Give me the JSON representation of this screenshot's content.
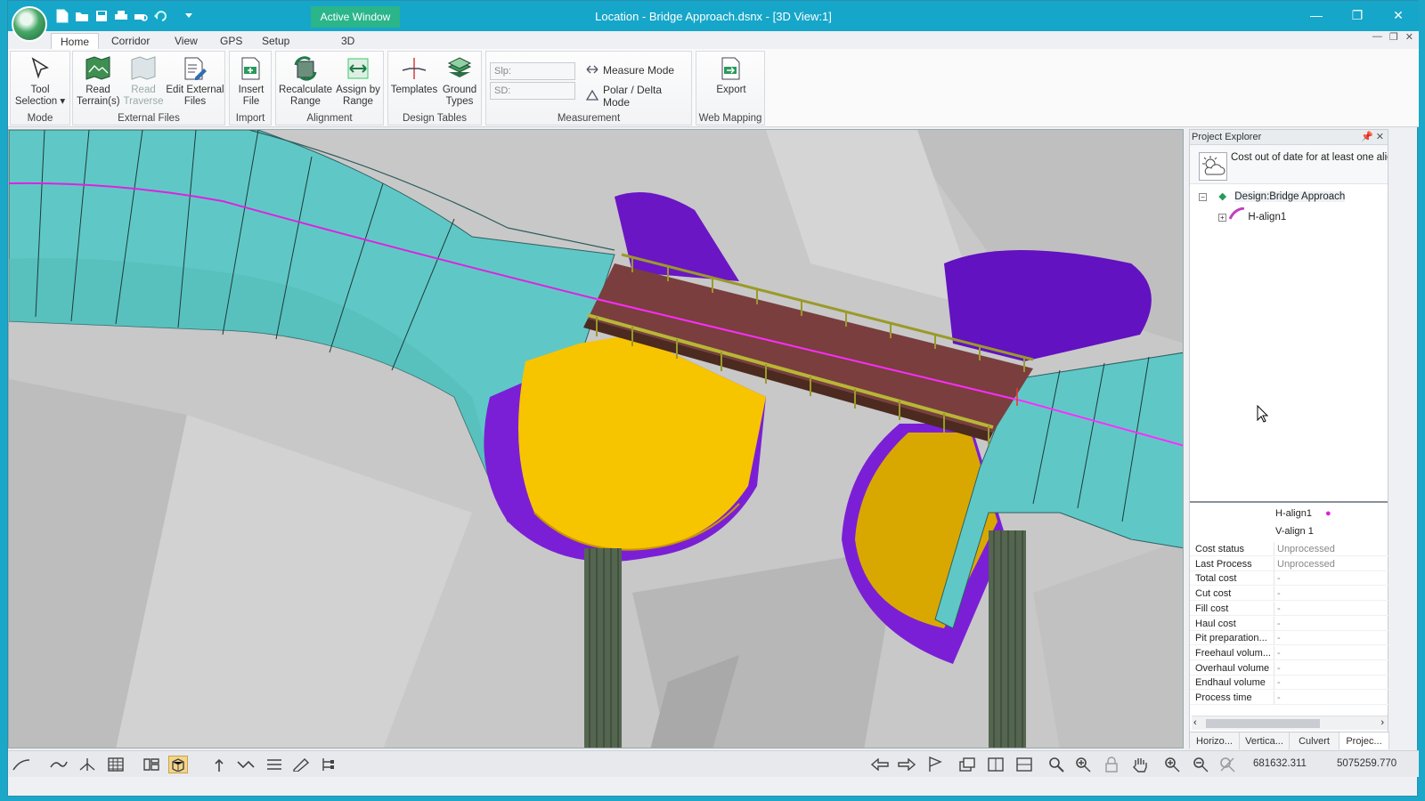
{
  "title_bar": {
    "title": "Location - Bridge Approach.dsnx - [3D View:1]",
    "active_window_label": "Active Window",
    "minimize": "—",
    "restore": "❐",
    "close": "✕"
  },
  "tabs": [
    {
      "label": "Home",
      "active": true
    },
    {
      "label": "Corridor"
    },
    {
      "label": "View"
    },
    {
      "label": "GPS"
    },
    {
      "label": "Setup"
    },
    {
      "label": "3D"
    }
  ],
  "ribbon": {
    "mode": {
      "label": "Mode",
      "tool_selection": "Tool Selection"
    },
    "external_files": {
      "label": "External Files",
      "read_terrain": "Read Terrain(s)",
      "read_traverse": "Read Traverse",
      "edit_external_files": "Edit External Files"
    },
    "import": {
      "label": "Import",
      "insert_file": "Insert File"
    },
    "alignment": {
      "label": "Alignment",
      "recalculate_range": "Recalculate Range",
      "assign_by_range": "Assign by Range"
    },
    "design_tables": {
      "label": "Design Tables",
      "templates": "Templates",
      "ground_types": "Ground Types"
    },
    "measurement": {
      "label": "Measurement",
      "slp_placeholder": "Slp:",
      "sd_placeholder": "SD:",
      "measure_mode": "Measure Mode",
      "polar_delta_mode": "Polar / Delta Mode"
    },
    "web_mapping": {
      "label": "Web Mapping",
      "export": "Export"
    }
  },
  "project_explorer": {
    "title": "Project Explorer",
    "status_message": "Cost out of date for at least one alignment",
    "tree": {
      "design_label": "Design:Bridge Approach",
      "child_label": "H-align1"
    },
    "properties": {
      "header_col1": "H-align1",
      "header_col1b": "V-align 1",
      "rows": [
        {
          "key": "Cost status",
          "value": "Unprocessed"
        },
        {
          "key": "Last Process",
          "value": "Unprocessed"
        },
        {
          "key": "Total cost",
          "value": "-"
        },
        {
          "key": "Cut cost",
          "value": "-"
        },
        {
          "key": "Fill cost",
          "value": "-"
        },
        {
          "key": "Haul cost",
          "value": "-"
        },
        {
          "key": "Pit preparation...",
          "value": "-"
        },
        {
          "key": "Freehaul volum...",
          "value": "-"
        },
        {
          "key": "Overhaul volume",
          "value": "-"
        },
        {
          "key": "Endhaul volume",
          "value": "-"
        },
        {
          "key": "Process time",
          "value": "-"
        }
      ]
    },
    "bottom_tabs": [
      "Horizo...",
      "Vertica...",
      "Culvert",
      "Projec..."
    ]
  },
  "status_bar": {
    "easting": "681632.311",
    "northing": "5075259.770"
  },
  "colors": {
    "titlebar": "#16a6c9",
    "road_surface": "#5fc8c6",
    "bridge_deck": "#7a3e3e",
    "slope_fill": "#f7c400",
    "slope_cut": "#7b1fd6",
    "alignment_line": "#e020e0"
  }
}
